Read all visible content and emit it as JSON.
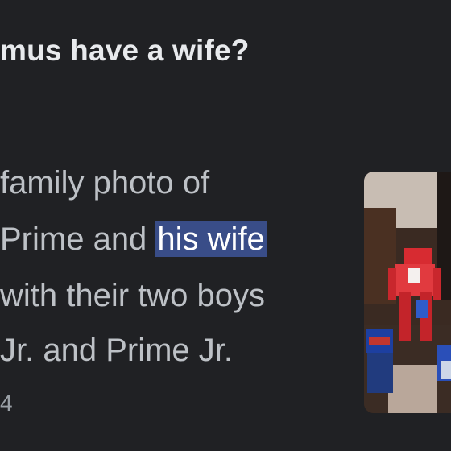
{
  "result": {
    "question": "mus have a wife?",
    "snippet": {
      "line1": "family photo of",
      "line2_before": "Prime and ",
      "line2_highlight": "his wife",
      "line3": " with their two boys",
      "line4": "Jr. and Prime Jr.",
      "date_fragment": "4"
    },
    "thumbnail": {
      "alt": "toy figures photo"
    }
  },
  "colors": {
    "background": "#202124",
    "question_text": "#e8eaed",
    "snippet_text": "#bdc1c6",
    "highlight_bg": "#394d88",
    "highlight_text": "#ffffff"
  }
}
